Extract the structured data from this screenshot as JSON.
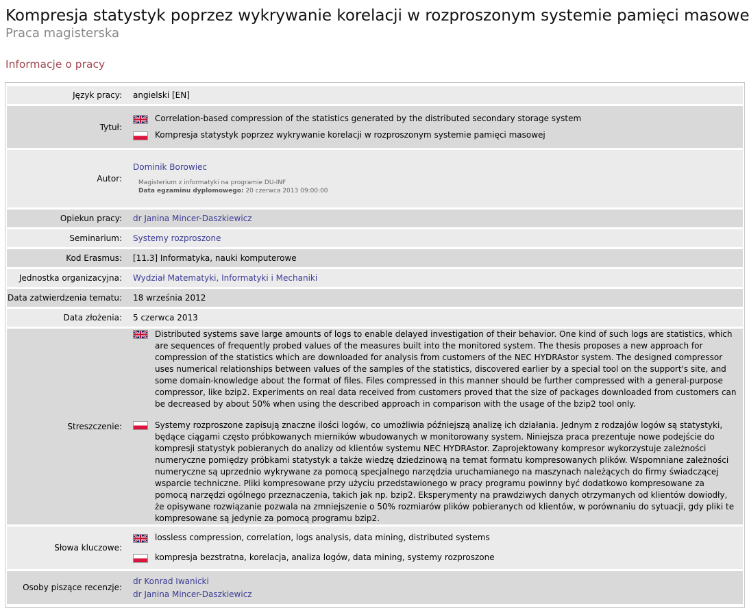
{
  "page": {
    "title": "Kompresja statystyk poprzez wykrywanie korelacji w rozproszonym systemie pamięci masowej",
    "subtitle": "Praca magisterska",
    "section_title": "Informacje o pracy"
  },
  "rows": {
    "language": {
      "label": "Język pracy:",
      "value": "angielski [EN]"
    },
    "title": {
      "label": "Tytuł:",
      "en": "Correlation-based compression of the statistics generated by the distributed secondary storage system",
      "pl": "Kompresja statystyk poprzez wykrywanie korelacji w rozproszonym systemie pamięci masowej"
    },
    "author": {
      "label": "Autor:",
      "name": "Dominik Borowiec",
      "program": "Magisterium z informatyki na programie DU-INF",
      "exam_label": "Data egzaminu dyplomowego:",
      "exam_date": "20 czerwca 2013 09:00:00"
    },
    "supervisor": {
      "label": "Opiekun pracy:",
      "value": "dr Janina Mincer-Daszkiewicz"
    },
    "seminar": {
      "label": "Seminarium:",
      "value": "Systemy rozproszone"
    },
    "erasmus": {
      "label": "Kod Erasmus:",
      "value": "[11.3] Informatyka, nauki komputerowe"
    },
    "unit": {
      "label": "Jednostka organizacyjna:",
      "value": "Wydział Matematyki, Informatyki i Mechaniki"
    },
    "approval": {
      "label": "Data zatwierdzenia tematu:",
      "value": "18 września 2012"
    },
    "submission": {
      "label": "Data złożenia:",
      "value": "5 czerwca 2013"
    },
    "abstract": {
      "label": "Streszczenie:",
      "en": "Distributed systems save large amounts of logs to enable delayed investigation of their behavior. One kind of such logs are statistics, which are sequences of frequently probed values of the measures built into the monitored system. The thesis proposes a new approach for compression of the statistics which are downloaded for analysis from customers of the NEC HYDRAstor system. The designed compressor uses numerical relationships between values of the samples of the statistics, discovered earlier by a special tool on the support's site, and some domain-knowledge about the format of files. Files compressed in this manner should be further compressed with a general-purpose compressor, like bzip2. Experiments on real data received from customers proved that the size of packages downloaded from customers can be decreased by about 50% when using the described approach in comparison with the usage of the bzip2 tool only.",
      "pl": "Systemy rozproszone zapisują znaczne ilości logów, co umożliwia późniejszą analizę ich działania. Jednym z rodzajów logów są statystyki, będące ciągami często próbkowanych mierników wbudowanych w monitorowany system. Niniejsza praca prezentuje nowe podejście do kompresji statystyk pobieranych do analizy od klientów systemu NEC HYDRAstor. Zaprojektowany kompresor wykorzystuje zależności numeryczne pomiędzy próbkami statystyk a także wiedzę dziedzinową na temat formatu kompresowanych plików. Wspomniane zależności numeryczne są uprzednio wykrywane za pomocą specjalnego narzędzia uruchamianego na maszynach należących do firmy świadczącej wsparcie techniczne. Pliki kompresowane przy użyciu przedstawionego w pracy programu powinny być dodatkowo kompresowane za pomocą narzędzi ogólnego przeznaczenia, takich jak np. bzip2. Eksperymenty na prawdziwych danych otrzymanych od klientów dowiodły, że opisywane rozwiązanie pozwala na zmniejszenie o 50% rozmiarów plików pobieranych od klientów, w porównaniu do sytuacji, gdy pliki te kompresowane są jedynie za pomocą programu bzip2."
    },
    "keywords": {
      "label": "Słowa kluczowe:",
      "en": "lossless compression, correlation, logs analysis, data mining, distributed systems",
      "pl": "kompresja bezstratna, korelacja, analiza logów, data mining, systemy rozproszone"
    },
    "reviewers": {
      "label": "Osoby piszące recenzje:",
      "items": [
        "dr Konrad Iwanicki",
        "dr Janina Mincer-Daszkiewicz"
      ]
    }
  },
  "icons": {
    "en_flag": "uk-flag-icon",
    "pl_flag": "poland-flag-icon"
  },
  "colors": {
    "link": "#3b3b96",
    "section_title": "#a0454d",
    "row_light": "#ebebeb",
    "row_dark": "#d9d9d9"
  }
}
